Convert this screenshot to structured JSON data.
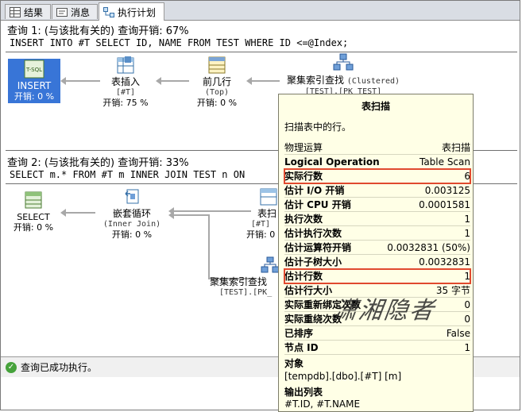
{
  "tabs": [
    {
      "label": "结果",
      "icon": "grid-icon"
    },
    {
      "label": "消息",
      "icon": "message-icon"
    },
    {
      "label": "执行计划",
      "icon": "plan-icon"
    }
  ],
  "query1": {
    "header": "查询 1: (与该批有关的) 查询开销: 67%",
    "sql": "INSERT INTO #T SELECT ID, NAME FROM TEST WHERE ID <=@Index;",
    "nodes": [
      {
        "label": "INSERT",
        "cost": "开销: 0 %",
        "icon_text": "T-SQL"
      },
      {
        "label": "表插入",
        "sub": "[#T]",
        "cost": "开销: 75 %"
      },
      {
        "label": "前几行",
        "sub": "(Top)",
        "cost": "开销: 0 %"
      },
      {
        "label": "聚集索引查找",
        "sub": "(Clustered)",
        "sub2": "[TEST].[PK_TEST]"
      }
    ]
  },
  "query2": {
    "header": "查询 2: (与该批有关的) 查询开销: 33%",
    "sql": "SELECT m.* FROM #T m INNER JOIN TEST n ON",
    "nodes": [
      {
        "label": "SELECT",
        "cost": "开销: 0 %"
      },
      {
        "label": "嵌套循环",
        "sub": "(Inner Join)",
        "cost": "开销: 0 %"
      },
      {
        "label": "表扫",
        "sub": "[#T]",
        "cost": "开销: 0"
      },
      {
        "label": "聚集索引查找",
        "sub": "[TEST].[PK_"
      }
    ]
  },
  "tooltip": {
    "title": "表扫描",
    "desc": "扫描表中的行。",
    "rows": [
      {
        "k": "物理运算",
        "v": "表扫描",
        "bold": false
      },
      {
        "k": "Logical Operation",
        "v": "Table Scan",
        "bold": true
      },
      {
        "k": "实际行数",
        "v": "6",
        "bold": true
      },
      {
        "k": "估计 I/O 开销",
        "v": "0.003125",
        "bold": true
      },
      {
        "k": "估计 CPU 开销",
        "v": "0.0001581",
        "bold": true
      },
      {
        "k": "执行次数",
        "v": "1",
        "bold": true
      },
      {
        "k": "估计执行次数",
        "v": "1",
        "bold": true
      },
      {
        "k": "估计运算符开销",
        "v": "0.0032831 (50%)",
        "bold": true
      },
      {
        "k": "估计子树大小",
        "v": "0.0032831",
        "bold": true
      },
      {
        "k": "估计行数",
        "v": "1",
        "bold": true
      },
      {
        "k": "估计行大小",
        "v": "35 字节",
        "bold": true
      },
      {
        "k": "实际重新绑定次数",
        "v": "0",
        "bold": true
      },
      {
        "k": "实际重绕次数",
        "v": "0",
        "bold": true
      },
      {
        "k": "已排序",
        "v": "False",
        "bold": true
      },
      {
        "k": "节点 ID",
        "v": "1",
        "bold": true
      }
    ],
    "object_label": "对象",
    "object_value": "[tempdb].[dbo].[#T] [m]",
    "output_label": "输出列表",
    "output_value": "#T.ID, #T.NAME"
  },
  "status": {
    "text": "查询已成功执行。"
  },
  "watermark": "潇湘隐者"
}
